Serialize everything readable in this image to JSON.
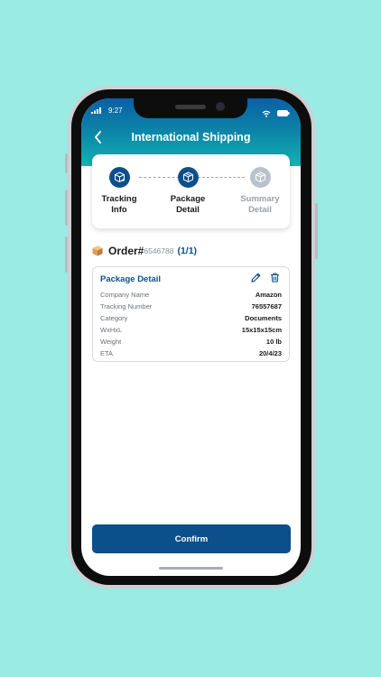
{
  "status_bar": {
    "time": "9:27"
  },
  "header": {
    "title": "International Shipping"
  },
  "steps": [
    {
      "label_1": "Tracking",
      "label_2": "Info",
      "state": "done",
      "icon": "box-arrow-icon"
    },
    {
      "label_1": "Package",
      "label_2": "Detail",
      "state": "active",
      "icon": "box-icon"
    },
    {
      "label_1": "Summary",
      "label_2": "Detail",
      "state": "inactive",
      "icon": "box-icon"
    }
  ],
  "order": {
    "label": "Order#",
    "number": "6546788",
    "count": "(1/1)"
  },
  "package": {
    "title": "Package Detail",
    "rows": [
      {
        "key": "Company Name",
        "value": "Amazon"
      },
      {
        "key": "Tracking Number",
        "value": "76557687"
      },
      {
        "key": "Category",
        "value": "Documents"
      },
      {
        "key": "WxHxL",
        "value": "15x15x15cm"
      },
      {
        "key": "Weight",
        "value": "10 lb"
      },
      {
        "key": "ETA",
        "value": "20/4/23"
      }
    ]
  },
  "confirm_label": "Confirm",
  "colors": {
    "primary": "#0d4f8a",
    "step_active": "#0d4f8a",
    "step_inactive": "#b9c3cc",
    "background": "#9aebe4"
  }
}
